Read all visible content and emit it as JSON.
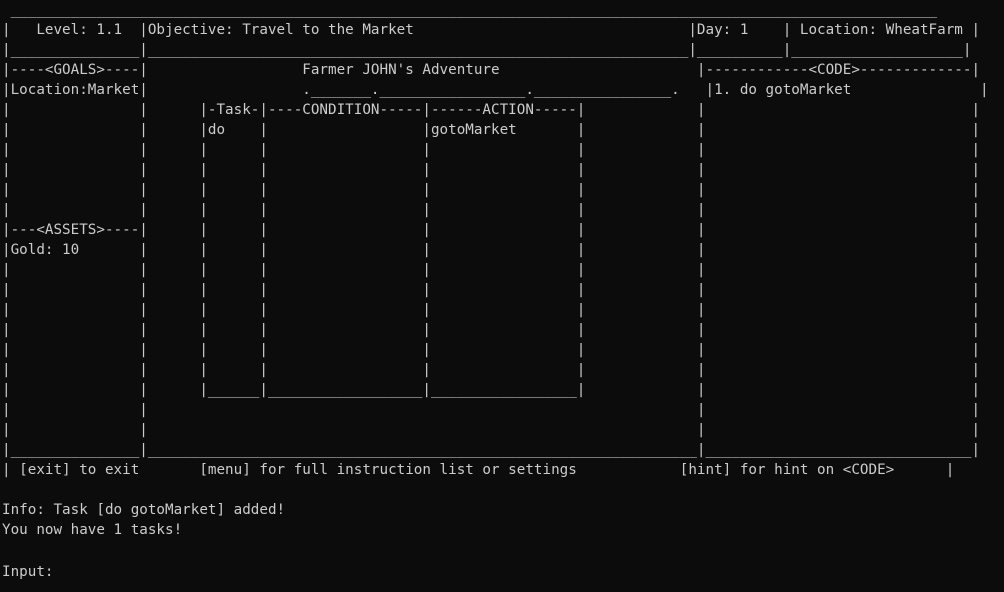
{
  "colors": {
    "background": "#0c0c0c",
    "foreground": "#cccccc"
  },
  "screen": [
    " ____________________________________________________________________________________________________________ ",
    "|   Level: 1.1  |Objective: Travel to the Market                                |Day: 1    | Location: WheatFarm |",
    "|_______________|_______________________________________________________________|__________|____________________|",
    "|----<GOALS>----|                  Farmer JOHN's Adventure                       |------------<CODE>-------------|",
    "|Location:Market|                  ._______._________________.________________.   |1. do gotoMarket               |",
    "|               |      |-Task-|----CONDITION-----|------ACTION-----|             |                               |",
    "|               |      |do    |                  |gotoMarket       |             |                               |",
    "|               |      |      |                  |                 |             |                               |",
    "|               |      |      |                  |                 |             |                               |",
    "|               |      |      |                  |                 |             |                               |",
    "|               |      |      |                  |                 |             |                               |",
    "|---<ASSETS>----|      |      |                  |                 |             |                               |",
    "|Gold: 10       |      |      |                  |                 |             |                               |",
    "|               |      |      |                  |                 |             |                               |",
    "|               |      |      |                  |                 |             |                               |",
    "|               |      |      |                  |                 |             |                               |",
    "|               |      |      |                  |                 |             |                               |",
    "|               |      |      |                  |                 |             |                               |",
    "|               |      |      |                  |                 |             |                               |",
    "|               |      |______|__________________|_________________|             |                               |",
    "|               |                                                                |                               |",
    "|               |                                                                |                               |",
    "|_______________|________________________________________________________________|_______________________________|",
    "| [exit] to exit       [menu] for full instruction list or settings            [hint] for hint on <CODE>      |",
    "",
    "Info: Task [do gotoMarket] added!",
    "You now have 1 tasks!",
    ""
  ],
  "prompt": "Input: "
}
